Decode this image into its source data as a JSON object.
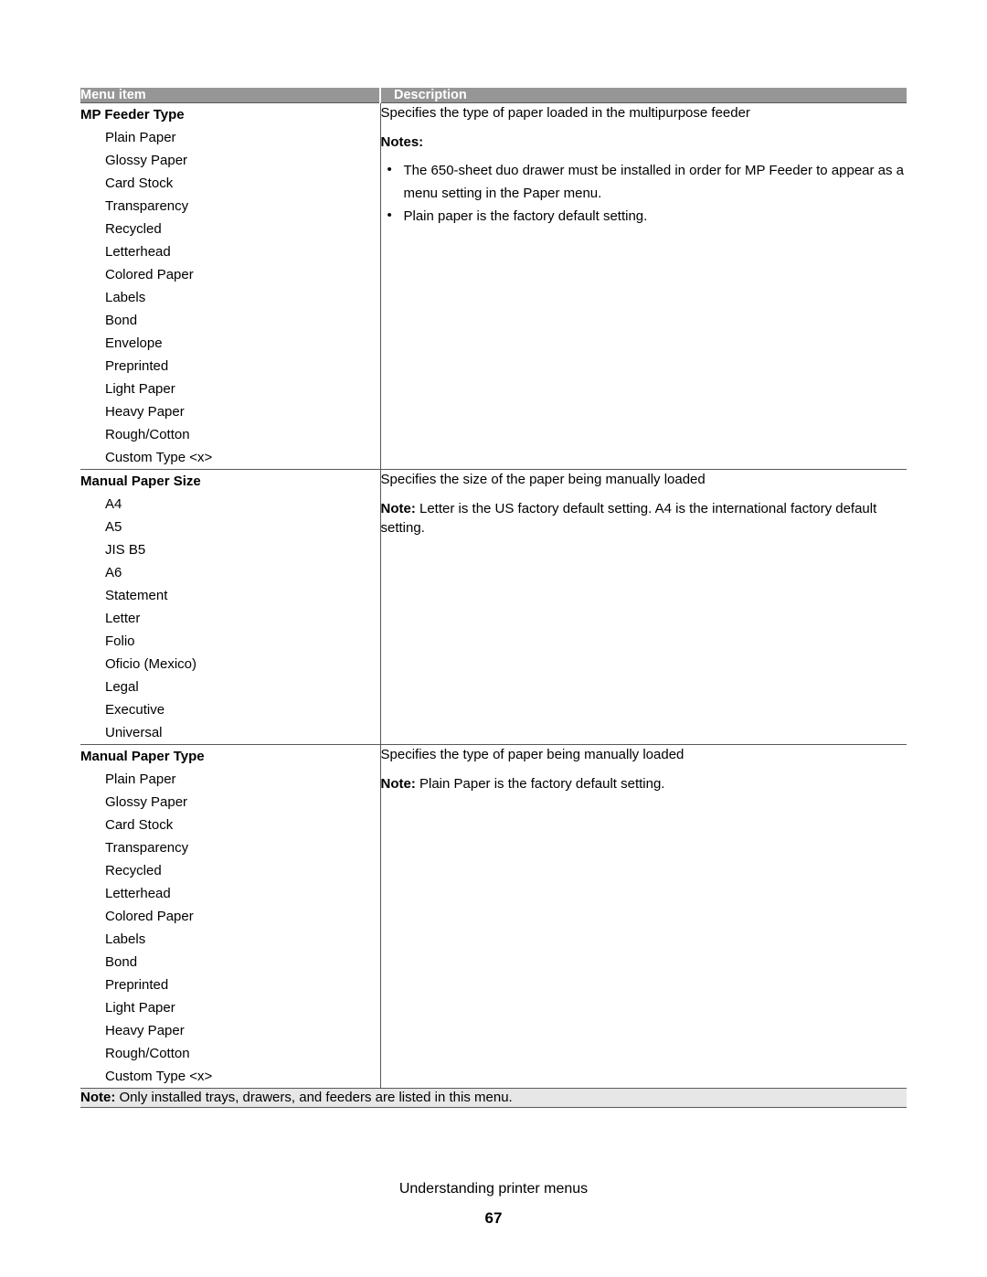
{
  "page": {
    "footer_title": "Understanding printer menus",
    "page_number": "67",
    "header_bg": "#969696",
    "footnote_bg": "#e7e7e7",
    "border_color": "#595959"
  },
  "table": {
    "headers": {
      "menu_item": "Menu item",
      "description": "Description"
    },
    "rows": [
      {
        "title": "MP Feeder Type",
        "options": [
          "Plain Paper",
          "Glossy Paper",
          "Card Stock",
          "Transparency",
          "Recycled",
          "Letterhead",
          "Colored Paper",
          "Labels",
          "Bond",
          "Envelope",
          "Preprinted",
          "Light Paper",
          "Heavy Paper",
          "Rough/Cotton",
          "Custom Type <x>"
        ],
        "description": {
          "summary": "Specifies the type of paper loaded in the multipurpose feeder",
          "notes_label": "Notes:",
          "bullets": [
            "The 650-sheet duo drawer must be installed in order for MP Feeder to appear as a menu setting in the Paper menu.",
            "Plain paper is the factory default setting."
          ]
        }
      },
      {
        "title": "Manual Paper Size",
        "options": [
          "A4",
          "A5",
          "JIS B5",
          "A6",
          "Statement",
          "Letter",
          "Folio",
          "Oficio (Mexico)",
          "Legal",
          "Executive",
          "Universal"
        ],
        "description": {
          "summary": "Specifies the size of the paper being manually loaded",
          "note_label": "Note:",
          "note_text": " Letter is the US factory default setting. A4 is the international factory default setting."
        }
      },
      {
        "title": "Manual Paper Type",
        "options": [
          "Plain Paper",
          "Glossy Paper",
          "Card Stock",
          "Transparency",
          "Recycled",
          "Letterhead",
          "Colored Paper",
          "Labels",
          "Bond",
          "Preprinted",
          "Light Paper",
          "Heavy Paper",
          "Rough/Cotton",
          "Custom Type <x>"
        ],
        "description": {
          "summary": "Specifies the type of paper being manually loaded",
          "note_label": "Note:",
          "note_text": " Plain Paper is the factory default setting."
        }
      }
    ],
    "footnote": {
      "label": "Note:",
      "text": " Only installed trays, drawers, and feeders are listed in this menu."
    }
  }
}
